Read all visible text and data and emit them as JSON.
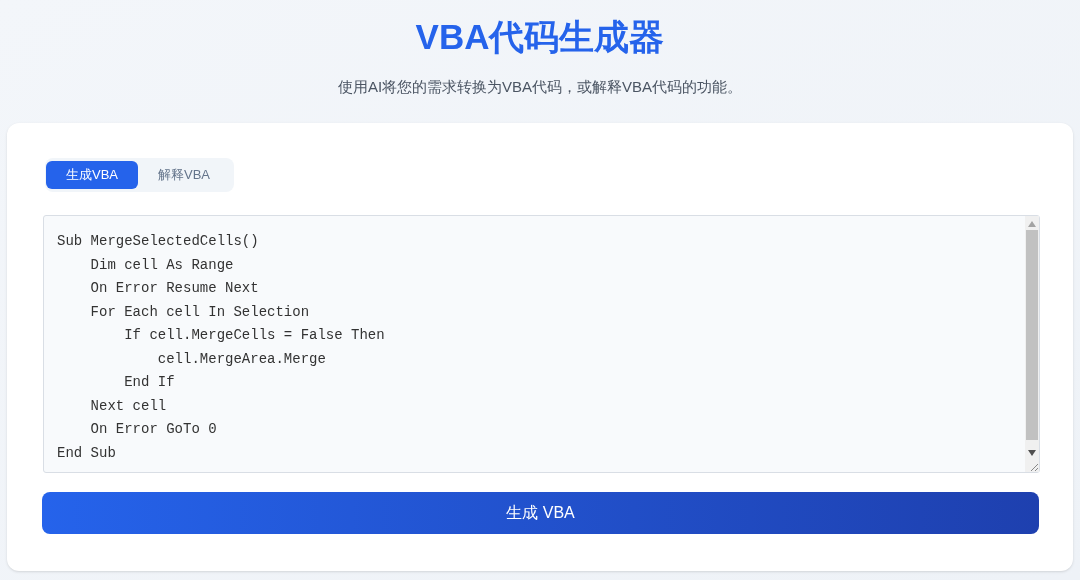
{
  "header": {
    "title": "VBA代码生成器",
    "subtitle": "使用AI将您的需求转换为VBA代码，或解释VBA代码的功能。"
  },
  "tabs": [
    {
      "label": "生成VBA",
      "selected": true
    },
    {
      "label": "解释VBA",
      "selected": false
    }
  ],
  "code_editor": {
    "lines": [
      "Sub MergeSelectedCells()",
      "    Dim cell As Range",
      "    On Error Resume Next",
      "    For Each cell In Selection",
      "        If cell.MergeCells = False Then",
      "            cell.MergeArea.Merge",
      "        End If",
      "    Next cell",
      "    On Error GoTo 0",
      "End Sub"
    ]
  },
  "submit_button": {
    "label": "生成 VBA"
  }
}
